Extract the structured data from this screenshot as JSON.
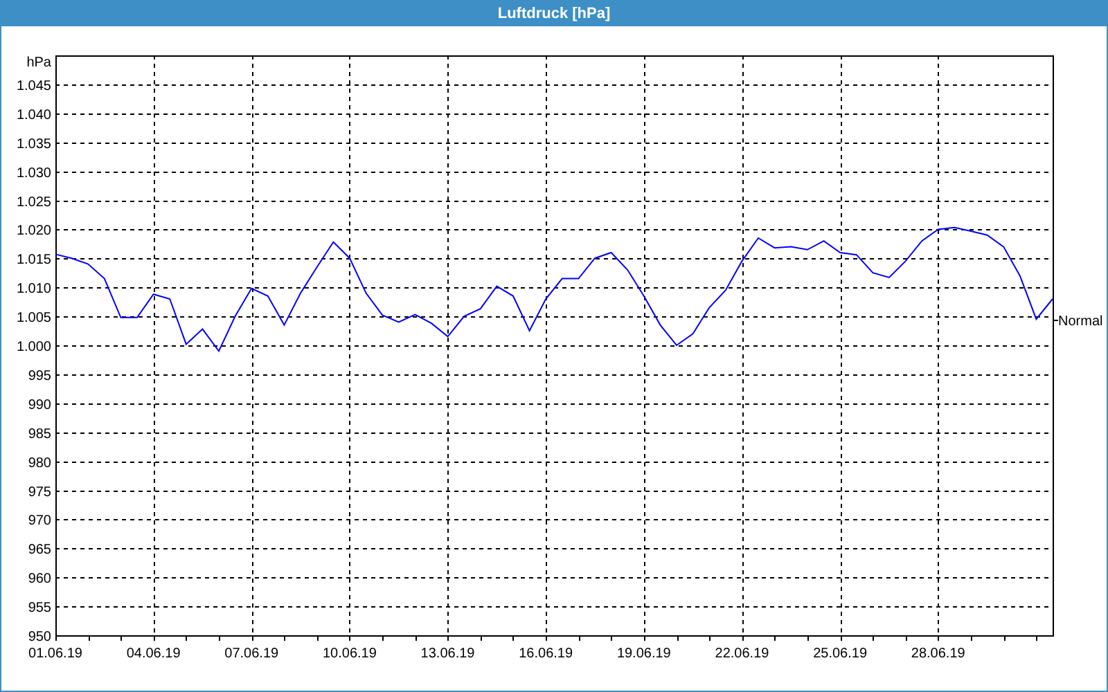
{
  "chart_data": {
    "type": "line",
    "title": "Luftdruck [hPa]",
    "ylabel": "hPa",
    "grid": true,
    "ylim": [
      950,
      1050
    ],
    "yticks": [
      {
        "value": 950,
        "label": "950"
      },
      {
        "value": 955,
        "label": "955"
      },
      {
        "value": 960,
        "label": "960"
      },
      {
        "value": 965,
        "label": "965"
      },
      {
        "value": 970,
        "label": "970"
      },
      {
        "value": 975,
        "label": "975"
      },
      {
        "value": 980,
        "label": "980"
      },
      {
        "value": 985,
        "label": "985"
      },
      {
        "value": 990,
        "label": "990"
      },
      {
        "value": 995,
        "label": "995"
      },
      {
        "value": 1000,
        "label": "1.000"
      },
      {
        "value": 1005,
        "label": "1.005"
      },
      {
        "value": 1010,
        "label": "1.010"
      },
      {
        "value": 1015,
        "label": "1.015"
      },
      {
        "value": 1020,
        "label": "1.020"
      },
      {
        "value": 1025,
        "label": "1.025"
      },
      {
        "value": 1030,
        "label": "1.030"
      },
      {
        "value": 1035,
        "label": "1.035"
      },
      {
        "value": 1040,
        "label": "1.040"
      },
      {
        "value": 1045,
        "label": "1.045"
      }
    ],
    "categories": [
      "01.06.19",
      null,
      null,
      null,
      null,
      null,
      "04.06.19",
      null,
      null,
      null,
      null,
      null,
      "07.06.19",
      null,
      null,
      null,
      null,
      null,
      "10.06.19",
      null,
      null,
      null,
      null,
      null,
      "13.06.19",
      null,
      null,
      null,
      null,
      null,
      "16.06.19",
      null,
      null,
      null,
      null,
      null,
      "19.06.19",
      null,
      null,
      null,
      null,
      null,
      "22.06.19",
      null,
      null,
      null,
      null,
      null,
      "25.06.19",
      null,
      null,
      null,
      null,
      null,
      "28.06.19",
      null,
      null,
      null,
      null,
      null,
      null,
      null
    ],
    "series": [
      {
        "color": "#0000ff",
        "values": [
          1015.7,
          1015,
          1014,
          1011.5,
          1004.8,
          1004.8,
          1008.8,
          1008,
          1000.2,
          1002.8,
          999,
          1005,
          1009.8,
          1008.5,
          1003.5,
          1009,
          1013.5,
          1017.8,
          1015,
          1009,
          1005.2,
          1004,
          1005.3,
          1003.8,
          1001.5,
          1005,
          1006.3,
          1010.2,
          1008.5,
          1002.5,
          1008,
          1011.5,
          1011.5,
          1015,
          1016,
          1013,
          1008.5,
          1003.5,
          1000,
          1002,
          1006.5,
          1009.5,
          1014.5,
          1018.5,
          1016.8,
          1017,
          1016.5,
          1018,
          1016,
          1015.6,
          1012.5,
          1011.7,
          1014.5,
          1018,
          1020,
          1020.3,
          1019.7,
          1019,
          1017,
          1012,
          1004.5,
          1008
        ]
      }
    ],
    "annotations": [
      "Normal"
    ]
  }
}
